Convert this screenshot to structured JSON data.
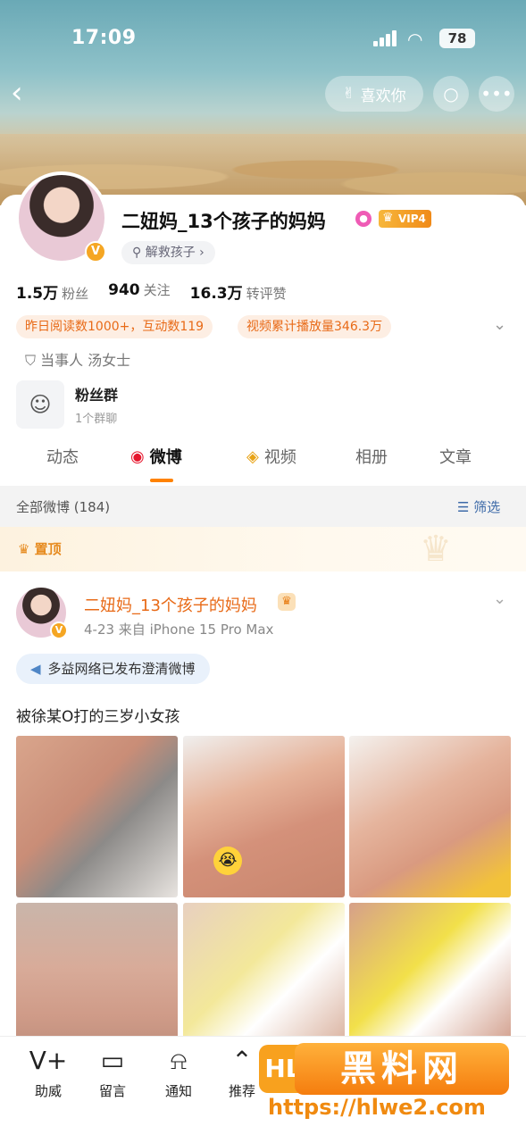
{
  "status": {
    "time": "17:09",
    "battery": "78"
  },
  "nav": {
    "like_label": "喜欢你"
  },
  "profile": {
    "name": "二妞妈_13个孩子的妈妈",
    "vip": "VIP4",
    "tag": "解救孩子 ›",
    "stats": [
      {
        "value": "1.5万",
        "label": "粉丝"
      },
      {
        "value": "940",
        "label": "关注"
      },
      {
        "value": "16.3万",
        "label": "转评赞"
      }
    ],
    "highlights": [
      "昨日阅读数1000+，互动数119",
      "视频累计播放量346.3万"
    ],
    "party": "当事人 汤女士",
    "fan_group": {
      "title": "粉丝群",
      "sub": "1个群聊"
    }
  },
  "tabs": [
    {
      "label": "动态"
    },
    {
      "label": "微博"
    },
    {
      "label": "视频"
    },
    {
      "label": "相册"
    },
    {
      "label": "文章"
    }
  ],
  "list": {
    "count_label": "全部微博 (184)",
    "filter_label": "筛选",
    "pinned_label": "置顶"
  },
  "post": {
    "name": "二妞妈_13个孩子的妈妈",
    "meta": "4-23  来自 iPhone 15 Pro Max",
    "notice": "多益网络已发布澄清微博",
    "text": "被徐某O打的三岁小女孩"
  },
  "toolbar": [
    {
      "label": "助威",
      "icon": "cheer-icon"
    },
    {
      "label": "留言",
      "icon": "message-icon"
    },
    {
      "label": "通知",
      "icon": "bell-icon"
    },
    {
      "label": "推荐",
      "icon": "recommend-icon"
    }
  ],
  "watermark": {
    "text": "黑料网",
    "logo": "HL",
    "url": "https://hlwe2.com"
  }
}
